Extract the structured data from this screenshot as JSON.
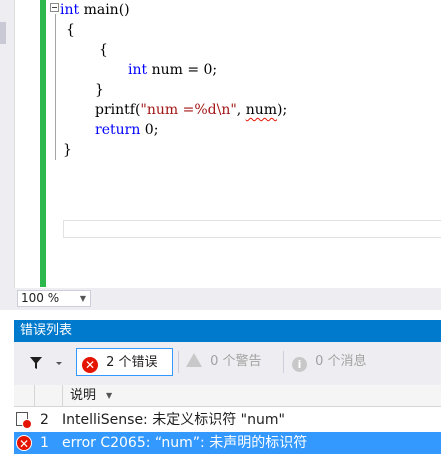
{
  "editor": {
    "lines": {
      "l1_kw": "int",
      "l1_rest": " main()",
      "l2": "{",
      "l3": "{",
      "l4_kw": "int",
      "l4_rest": " num = 0;",
      "l5": "}",
      "l6_fn": "printf(",
      "l6_str": "\"num =%d\\n\"",
      "l6_mid": ", ",
      "l6_err": "num",
      "l6_end": ");",
      "l7_kw": "return",
      "l7_rest": " 0;",
      "l8": "}"
    }
  },
  "zoom": {
    "value": "100 %"
  },
  "error_list": {
    "title": "错误列表",
    "errors_btn": "2 个错误",
    "warnings_btn": "0 个警告",
    "messages_btn": "0 个消息",
    "header_description": "说明",
    "rows": [
      {
        "num": "2",
        "text": "IntelliSense: 未定义标识符 \"num\""
      },
      {
        "num": "1",
        "text": "error C2065: “num”: 未声明的标识符"
      }
    ]
  },
  "colors": {
    "accent": "#007acc",
    "selection": "#3399ff",
    "error": "#e51400",
    "change_bar": "#2db84d"
  }
}
